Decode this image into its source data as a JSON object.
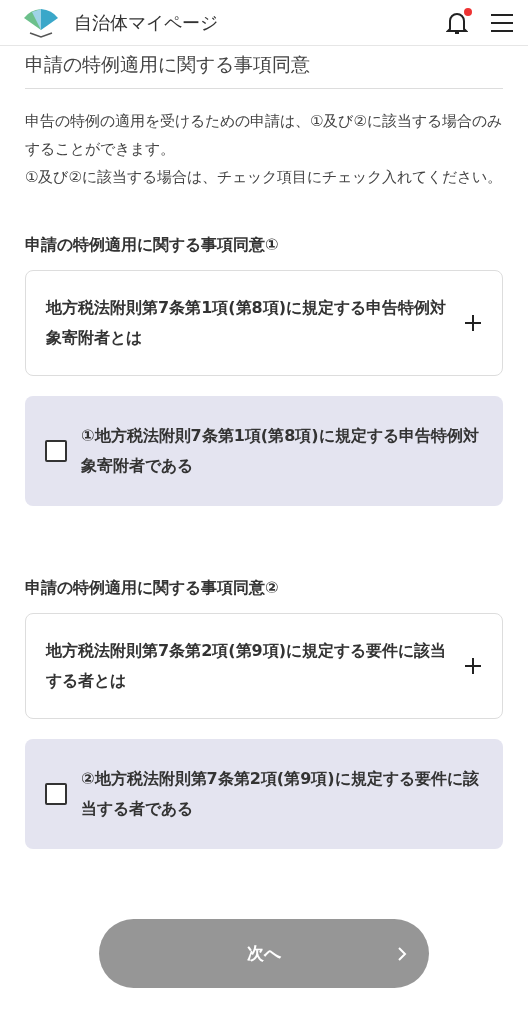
{
  "header": {
    "title": "自治体マイページ",
    "has_notification": true
  },
  "page_title": "申請の特例適用に関する事項同意",
  "intro": [
    "申告の特例の適用を受けるための申請は、①及び②に該当する場合のみすることができます。",
    "①及び②に該当する場合は、チェック項目にチェック入れてください。"
  ],
  "sections": [
    {
      "heading": "申請の特例適用に関する事項同意①",
      "accordion": {
        "label": "地方税法附則第7条第1項(第8項)に規定する申告特例対象寄附者とは",
        "expanded": false
      },
      "checkbox": {
        "label": "①地方税法附則7条第1項(第8項)に規定する申告特例対象寄附者である",
        "checked": false
      }
    },
    {
      "heading": "申請の特例適用に関する事項同意②",
      "accordion": {
        "label": "地方税法附則第7条第2項(第9項)に規定する要件に該当する者とは",
        "expanded": false
      },
      "checkbox": {
        "label": "②地方税法附則第7条第2項(第9項)に規定する要件に該当する者である",
        "checked": false
      }
    }
  ],
  "next_button": {
    "label": "次へ",
    "disabled": true
  }
}
